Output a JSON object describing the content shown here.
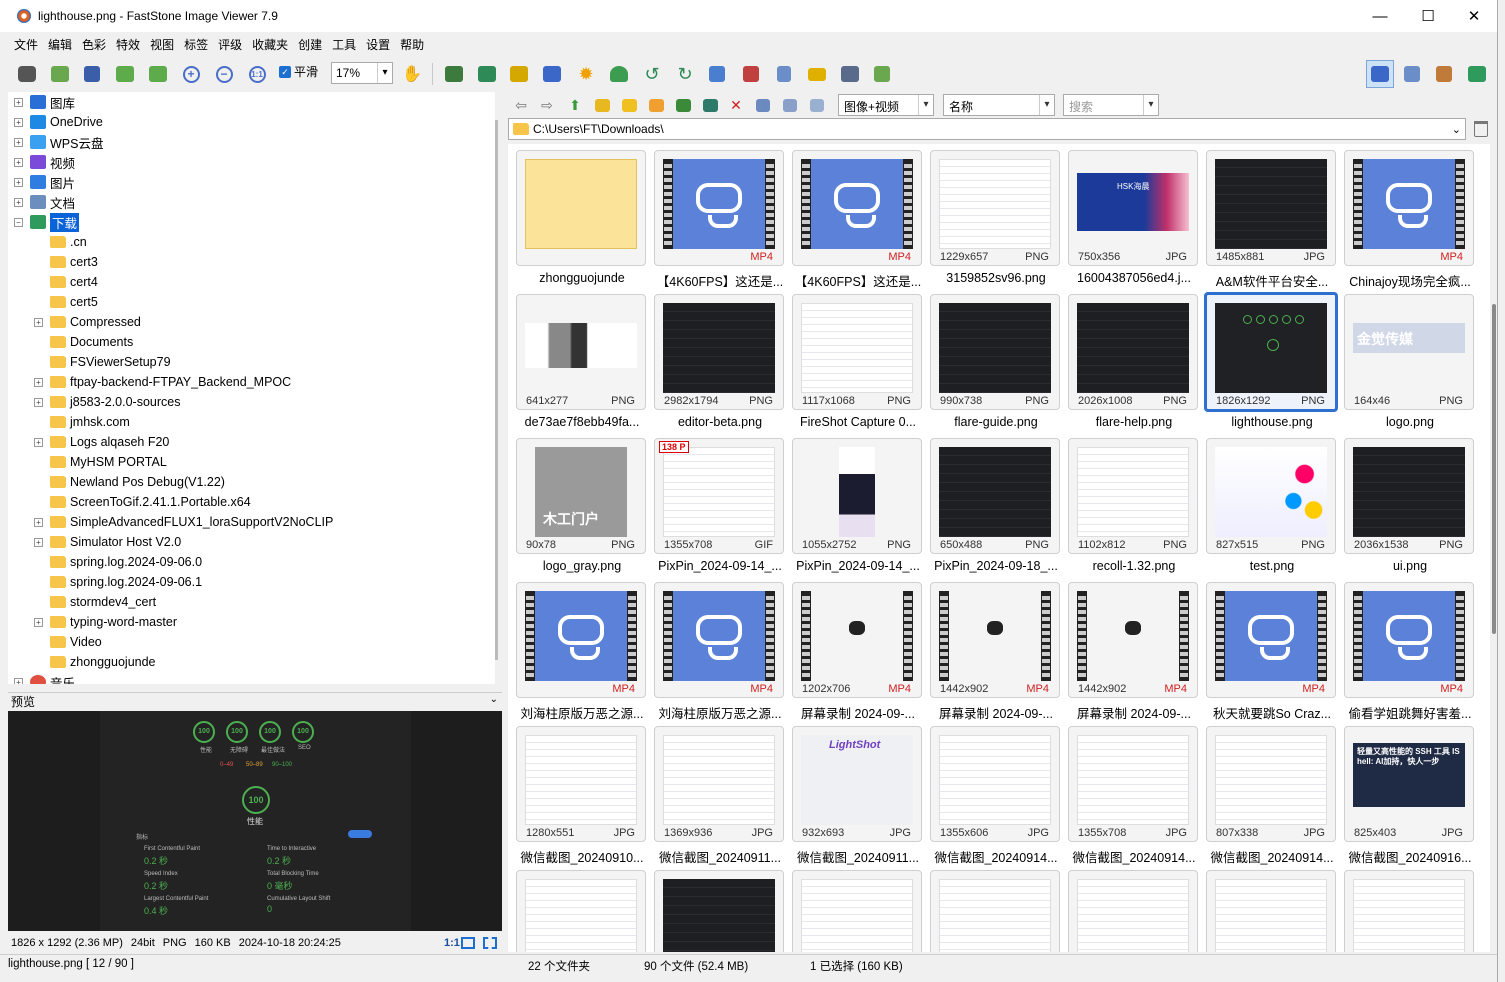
{
  "window": {
    "title": "lighthouse.png - FastStone Image Viewer 7.9",
    "minimize": "—",
    "maximize": "☐",
    "close": "✕"
  },
  "menu": [
    "文件",
    "编辑",
    "色彩",
    "特效",
    "视图",
    "标签",
    "评级",
    "收藏夹",
    "创建",
    "工具",
    "设置",
    "帮助"
  ],
  "toolbar": {
    "smooth_label": "平滑",
    "smooth_checked": true,
    "zoom": "17%"
  },
  "tree": {
    "top": [
      {
        "label": "图库",
        "icon": "gallery-icon",
        "color": "#2a6fd6"
      },
      {
        "label": "OneDrive",
        "icon": "onedrive-icon",
        "color": "#1e88e5"
      },
      {
        "label": "WPS云盘",
        "icon": "cloud-icon",
        "color": "#3aa0f0"
      },
      {
        "label": "视频",
        "icon": "video-folder-icon",
        "color": "#7b4ad8"
      },
      {
        "label": "图片",
        "icon": "pictures-folder-icon",
        "color": "#2f7de0"
      },
      {
        "label": "文档",
        "icon": "documents-folder-icon",
        "color": "#6c8ebf"
      },
      {
        "label": "下载",
        "icon": "download-icon",
        "color": "#2e9b5d"
      }
    ],
    "children": [
      {
        "label": ".cn",
        "expandable": false
      },
      {
        "label": "cert3",
        "expandable": false
      },
      {
        "label": "cert4",
        "expandable": false
      },
      {
        "label": "cert5",
        "expandable": false
      },
      {
        "label": "Compressed",
        "expandable": true
      },
      {
        "label": "Documents",
        "expandable": false
      },
      {
        "label": "FSViewerSetup79",
        "expandable": false
      },
      {
        "label": "ftpay-backend-FTPAY_Backend_MPOC",
        "expandable": true
      },
      {
        "label": "j8583-2.0.0-sources",
        "expandable": true
      },
      {
        "label": "jmhsk.com",
        "expandable": false
      },
      {
        "label": "Logs alqaseh F20",
        "expandable": true
      },
      {
        "label": "MyHSM PORTAL",
        "expandable": false
      },
      {
        "label": "Newland Pos Debug(V1.22)",
        "expandable": false
      },
      {
        "label": "ScreenToGif.2.41.1.Portable.x64",
        "expandable": false
      },
      {
        "label": "SimpleAdvancedFLUX1_loraSupportV2NoCLIP",
        "expandable": true
      },
      {
        "label": "Simulator Host V2.0",
        "expandable": true
      },
      {
        "label": "spring.log.2024-09-06.0",
        "expandable": false
      },
      {
        "label": "spring.log.2024-09-06.1",
        "expandable": false
      },
      {
        "label": "stormdev4_cert",
        "expandable": false
      },
      {
        "label": "typing-word-master",
        "expandable": true
      },
      {
        "label": "Video",
        "expandable": false
      },
      {
        "label": "zhongguojunde",
        "expandable": false
      }
    ],
    "last": {
      "label": "音乐"
    }
  },
  "preview": {
    "header": "预览",
    "gauges": [
      "100",
      "100",
      "100",
      "100"
    ],
    "gauge_labels": [
      "性能",
      "无障碍",
      "最佳做法",
      "SEO"
    ],
    "legend": [
      "0–49",
      "50–89",
      "90–100"
    ],
    "big_gauge": "100",
    "big_label": "性能",
    "metrics_title": "指标",
    "metrics": [
      {
        "name": "First Contentful Paint",
        "value": "0.2 秒"
      },
      {
        "name": "Time to Interactive",
        "value": "0.2 秒"
      },
      {
        "name": "Speed Index",
        "value": "0.2 秒"
      },
      {
        "name": "Total Blocking Time",
        "value": "0 毫秒"
      },
      {
        "name": "Largest Contentful Paint",
        "value": "0.4 秒"
      },
      {
        "name": "Cumulative Layout Shift",
        "value": "0"
      }
    ],
    "info": {
      "size": "1826 x 1292 (2.36 MP)",
      "bit": "24bit",
      "format": "PNG",
      "filesize": "160 KB",
      "date": "2024-10-18 20:24:25",
      "ratio": "1:1"
    }
  },
  "browser": {
    "filter": "图像+视频",
    "sort": "名称",
    "search_placeholder": "搜索",
    "path": "C:\\Users\\FT\\Downloads\\"
  },
  "thumbs": [
    {
      "caption": "zhongguojunde",
      "dim": "",
      "ext": "",
      "kind": "folder"
    },
    {
      "caption": "【4K60FPS】这还是...",
      "dim": "",
      "ext": "MP4",
      "kind": "video"
    },
    {
      "caption": "【4K60FPS】这还是...",
      "dim": "",
      "ext": "MP4",
      "kind": "video"
    },
    {
      "caption": "3159852sv96.png",
      "dim": "1229x657",
      "ext": "PNG",
      "kind": "light"
    },
    {
      "caption": "16004387056ed4.j...",
      "dim": "750x356",
      "ext": "JPG",
      "kind": "hsk"
    },
    {
      "caption": "A&M软件平台安全...",
      "dim": "1485x881",
      "ext": "JPG",
      "kind": "dark"
    },
    {
      "caption": "Chinajoy现场完全疯...",
      "dim": "",
      "ext": "MP4",
      "kind": "video"
    },
    {
      "caption": "de73ae7f8ebb49fa...",
      "dim": "641x277",
      "ext": "PNG",
      "kind": "machine"
    },
    {
      "caption": "editor-beta.png",
      "dim": "2982x1794",
      "ext": "PNG",
      "kind": "dark"
    },
    {
      "caption": "FireShot Capture 0...",
      "dim": "1117x1068",
      "ext": "PNG",
      "kind": "light"
    },
    {
      "caption": "flare-guide.png",
      "dim": "990x738",
      "ext": "PNG",
      "kind": "dark"
    },
    {
      "caption": "flare-help.png",
      "dim": "2026x1008",
      "ext": "PNG",
      "kind": "dark"
    },
    {
      "caption": "lighthouse.png",
      "dim": "1826x1292",
      "ext": "PNG",
      "kind": "lh",
      "selected": true
    },
    {
      "caption": "logo.png",
      "dim": "164x46",
      "ext": "PNG",
      "kind": "logo"
    },
    {
      "caption": "logo_gray.png",
      "dim": "90x78",
      "ext": "PNG",
      "kind": "gray"
    },
    {
      "caption": "PixPin_2024-09-14_...",
      "dim": "1355x708",
      "ext": "GIF",
      "kind": "light",
      "badge": "138 P"
    },
    {
      "caption": "PixPin_2024-09-14_...",
      "dim": "1055x2752",
      "ext": "PNG",
      "kind": "tall"
    },
    {
      "caption": "PixPin_2024-09-18_...",
      "dim": "650x488",
      "ext": "PNG",
      "kind": "dark"
    },
    {
      "caption": "recoll-1.32.png",
      "dim": "1102x812",
      "ext": "PNG",
      "kind": "light"
    },
    {
      "caption": "test.png",
      "dim": "827x515",
      "ext": "PNG",
      "kind": "colorful"
    },
    {
      "caption": "ui.png",
      "dim": "2036x1538",
      "ext": "PNG",
      "kind": "dark"
    },
    {
      "caption": "刘海柱原版万恶之源...",
      "dim": "",
      "ext": "MP4",
      "kind": "video"
    },
    {
      "caption": "刘海柱原版万恶之源...",
      "dim": "",
      "ext": "MP4",
      "kind": "video"
    },
    {
      "caption": "屏幕录制 2024-09-...",
      "dim": "1202x706",
      "ext": "MP4",
      "kind": "filmlight"
    },
    {
      "caption": "屏幕录制 2024-09-...",
      "dim": "1442x902",
      "ext": "MP4",
      "kind": "filmlight"
    },
    {
      "caption": "屏幕录制 2024-09-...",
      "dim": "1442x902",
      "ext": "MP4",
      "kind": "filmlight"
    },
    {
      "caption": "秋天就要跳So Craz...",
      "dim": "",
      "ext": "MP4",
      "kind": "video"
    },
    {
      "caption": "偷看学姐跳舞好害羞...",
      "dim": "",
      "ext": "MP4",
      "kind": "video"
    },
    {
      "caption": "微信截图_20240910...",
      "dim": "1280x551",
      "ext": "JPG",
      "kind": "light"
    },
    {
      "caption": "微信截图_20240911...",
      "dim": "1369x936",
      "ext": "JPG",
      "kind": "light"
    },
    {
      "caption": "微信截图_20240911...",
      "dim": "932x693",
      "ext": "JPG",
      "kind": "lightshot"
    },
    {
      "caption": "微信截图_20240914...",
      "dim": "1355x606",
      "ext": "JPG",
      "kind": "light"
    },
    {
      "caption": "微信截图_20240914...",
      "dim": "1355x708",
      "ext": "JPG",
      "kind": "light"
    },
    {
      "caption": "微信截图_20240914...",
      "dim": "807x338",
      "ext": "JPG",
      "kind": "light"
    },
    {
      "caption": "微信截图_20240916...",
      "dim": "825x403",
      "ext": "JPG",
      "kind": "ssh"
    },
    {
      "caption": "",
      "dim": "",
      "ext": "",
      "kind": "light"
    },
    {
      "caption": "",
      "dim": "",
      "ext": "",
      "kind": "dark"
    },
    {
      "caption": "",
      "dim": "",
      "ext": "",
      "kind": "light"
    },
    {
      "caption": "",
      "dim": "",
      "ext": "",
      "kind": "light"
    },
    {
      "caption": "",
      "dim": "",
      "ext": "",
      "kind": "light"
    },
    {
      "caption": "",
      "dim": "",
      "ext": "",
      "kind": "light"
    },
    {
      "caption": "",
      "dim": "",
      "ext": "",
      "kind": "light"
    }
  ],
  "thumb_texts": {
    "hsk": "HSK海晨",
    "logo": "金觉传媒",
    "gray": "木工门户",
    "ssh": "轻量又高性能的 SSH 工具 IS hell: AI加持，快人一步",
    "lightshot": "LightShot"
  },
  "status": {
    "file": "lighthouse.png [ 12 / 90 ]",
    "folders": "22 个文件夹",
    "files": "90 个文件 (52.4 MB)",
    "selected": "1 已选择 (160 KB)"
  }
}
